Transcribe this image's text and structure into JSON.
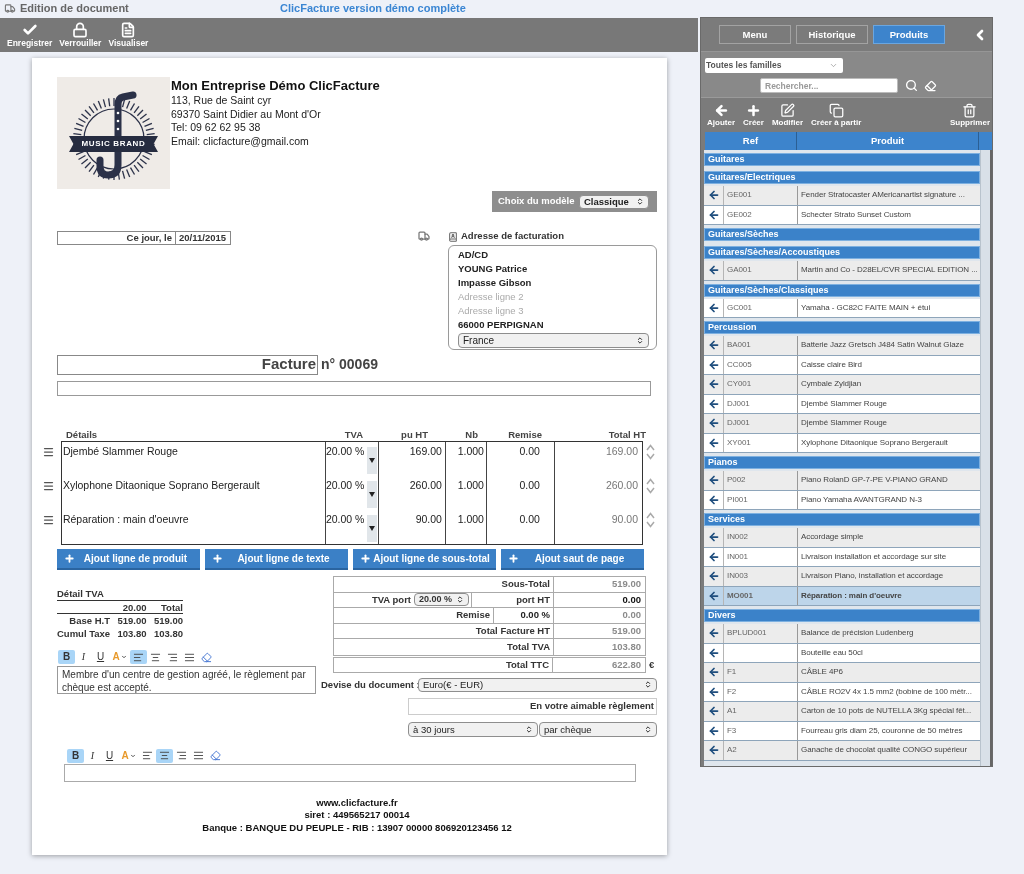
{
  "header": {
    "title": "Edition de document",
    "subtitle": "ClicFacture version démo complète"
  },
  "toolbar": [
    "Enregistrer",
    "Verrouiller",
    "Visualiser"
  ],
  "company": {
    "logo_text": "MUSIC BRAND",
    "name": "Mon Entreprise Démo ClicFacture",
    "lines": [
      "113, Rue de Saint cyr",
      "69370 Saint Didier au Mont d'Or",
      "Tel: 09 62 62 95 38",
      "Email: clicfacture@gmail.com"
    ]
  },
  "template": {
    "label": "Choix du modèle",
    "value": "Classique"
  },
  "date": {
    "label": "Ce jour, le",
    "value": "20/11/2015"
  },
  "billing_address": {
    "title": "Adresse de facturation",
    "lines": [
      {
        "value": "AD/CD"
      },
      {
        "value": "YOUNG Patrice"
      },
      {
        "value": "Impasse Gibson"
      },
      {
        "placeholder": "Adresse ligne 2"
      },
      {
        "placeholder": "Adresse ligne 3"
      },
      {
        "value": "66000 PERPIGNAN"
      }
    ],
    "country": "France"
  },
  "document": {
    "type": "Facture",
    "number": "n° 00069"
  },
  "lines_table": {
    "columns": [
      "Détails",
      "TVA",
      "pu HT",
      "Nb",
      "Remise",
      "Total HT"
    ],
    "rows": [
      {
        "details": "Djembé Slammer Rouge",
        "tva": "20.00 %",
        "pu_ht": "169.00",
        "nb": "1.000",
        "remise": "0.00",
        "total_ht": "169.00"
      },
      {
        "details": "Xylophone Ditaonique Soprano Bergerault",
        "tva": "20.00 %",
        "pu_ht": "260.00",
        "nb": "1.000",
        "remise": "0.00",
        "total_ht": "260.00"
      },
      {
        "details": "Réparation : main d'oeuvre",
        "tva": "20.00 %",
        "pu_ht": "90.00",
        "nb": "1.000",
        "remise": "0.00",
        "total_ht": "90.00"
      }
    ]
  },
  "add_buttons": [
    "Ajout ligne de produit",
    "Ajout ligne de texte",
    "Ajout ligne de sous-total",
    "Ajout saut de page"
  ],
  "tva_detail": {
    "title": "Détail TVA",
    "columns": [
      "20.00",
      "Total"
    ],
    "rows": [
      {
        "label": "Base H.T",
        "values": [
          "519.00",
          "519.00"
        ]
      },
      {
        "label": "Cumul Taxe",
        "values": [
          "103.80",
          "103.80"
        ]
      }
    ]
  },
  "totals": [
    {
      "kind": "plain",
      "label": "Sous-Total",
      "value": "519.00"
    },
    {
      "kind": "shipping",
      "label": "TVA port",
      "rate": "20.00 %",
      "sublabel": "port HT",
      "value": "0.00"
    },
    {
      "kind": "discount",
      "label": "Remise",
      "rate": "0.00 %",
      "value": "0.00"
    },
    {
      "kind": "plain",
      "label": "Total Facture HT",
      "value": "519.00"
    },
    {
      "kind": "plain",
      "label": "Total TVA",
      "value": "103.80"
    },
    {
      "kind": "grand",
      "label": "Total TTC",
      "value": "622.80",
      "currency": "€"
    }
  ],
  "notes_editor": {
    "styles": [
      {
        "label": "B",
        "selected": true
      },
      {
        "label": "I",
        "selected": false
      },
      {
        "label": "U",
        "selected": false
      }
    ],
    "color": {
      "label": "A"
    },
    "alignment": [
      {
        "selected": true
      },
      {
        "selected": false
      },
      {
        "selected": false
      },
      {
        "selected": false
      }
    ],
    "value": "Membre d'un centre de gestion agréé, le règlement par chèque est accepté."
  },
  "currency": {
    "label": "Devise du document :",
    "value": "Euro(€ - EUR)"
  },
  "payment": {
    "text": "En votre aimable règlement",
    "term": "à 30 jours",
    "method": "par chèque"
  },
  "footer_editor": {
    "styles": [
      {
        "label": "B",
        "selected": true
      },
      {
        "label": "I",
        "selected": false
      },
      {
        "label": "U",
        "selected": false
      }
    ],
    "color": {
      "label": "A"
    },
    "alignment": [
      {
        "selected": false
      },
      {
        "selected": true
      },
      {
        "selected": false
      },
      {
        "selected": false
      }
    ]
  },
  "footer": [
    "www.clicfacture.fr",
    "siret : 449565217 00014",
    "Banque : BANQUE DU PEUPLE - RIB : 13907 00000 806920123456 12"
  ],
  "panel": {
    "tabs": [
      {
        "label": "Menu",
        "selected": false
      },
      {
        "label": "Historique",
        "selected": false
      },
      {
        "label": "Produits",
        "selected": true
      }
    ],
    "family_filter": "Toutes les familles",
    "search": {
      "placeholder": "Rechercher..."
    },
    "actions": [
      "Ajouter",
      "Créer",
      "Modifier",
      "Créer à partir",
      "Supprimer"
    ],
    "columns": [
      "Ref",
      "Produit"
    ],
    "groups": [
      {
        "name": "Guitares"
      },
      {
        "name": "Guitares/Electriques",
        "products": [
          {
            "ref": "GE001",
            "name": "Fender Stratocaster AMericanartist signature ...",
            "selected": false
          },
          {
            "ref": "GE002",
            "name": "Schecter Strato Sunset Custom",
            "selected": false
          }
        ]
      },
      {
        "name": "Guitares/Sèches"
      },
      {
        "name": "Guitares/Sèches/Accoustiques",
        "products": [
          {
            "ref": "GA001",
            "name": "Martin and Co - D28EL/CVR SPECIAL EDITION ...",
            "selected": false
          }
        ]
      },
      {
        "name": "Guitares/Sèches/Classiques",
        "products": [
          {
            "ref": "GC001",
            "name": "Yamaha - GC82C FAITE MAIN + étui",
            "selected": false
          }
        ]
      },
      {
        "name": "Percussion",
        "products": [
          {
            "ref": "BA001",
            "name": "Batterie Jazz Gretsch J484 Satin Walnut Glaze",
            "selected": false
          },
          {
            "ref": "CC005",
            "name": "Caisse claire Bird",
            "selected": false
          },
          {
            "ref": "CY001",
            "name": "Cymbale Zyldjian",
            "selected": false
          },
          {
            "ref": "DJ001",
            "name": "Djembé Slammer Rouge",
            "selected": false
          },
          {
            "ref": "DJ001",
            "name": "Djembé Slammer Rouge",
            "selected": false
          },
          {
            "ref": "XY001",
            "name": "Xylophone Ditaonique Soprano Bergerault",
            "selected": false
          }
        ]
      },
      {
        "name": "Pianos",
        "products": [
          {
            "ref": "P002",
            "name": "Piano RolanD GP-7-PE V-PIANO GRAND",
            "selected": false
          },
          {
            "ref": "PI001",
            "name": "Piano Yamaha AVANTGRAND N-3",
            "selected": false
          }
        ]
      },
      {
        "name": "Services",
        "products": [
          {
            "ref": "IN002",
            "name": "Accordage simple",
            "selected": false
          },
          {
            "ref": "IN001",
            "name": "Livraison installation et accordage sur site",
            "selected": false
          },
          {
            "ref": "IN003",
            "name": "Livraison Piano, installation et accordage",
            "selected": false
          },
          {
            "ref": "MO001",
            "name": "Réparation : main d'oeuvre",
            "selected": true
          }
        ]
      },
      {
        "name": "Divers",
        "products": [
          {
            "ref": "BPLUD001",
            "name": "Balance de précision Ludenberg",
            "selected": false
          },
          {
            "name": "Bouteille eau 50cl",
            "selected": false
          },
          {
            "ref": "F1",
            "name": "CÂBLE 4P6",
            "selected": false
          },
          {
            "ref": "F2",
            "name": "CÂBLE RO2V 4x 1.5 mm2 (bobine de 100 mètr...",
            "selected": false
          },
          {
            "ref": "A1",
            "name": "Carton de 10 pots de NUTELLA 3Kg spécial fêt...",
            "selected": false
          },
          {
            "ref": "F3",
            "name": "Fourreau gris diam 25, couronne de 50 mètres",
            "selected": false
          },
          {
            "ref": "A2",
            "name": "Ganache de chocolat qualité CONGO supérieur",
            "selected": false
          }
        ]
      }
    ]
  }
}
